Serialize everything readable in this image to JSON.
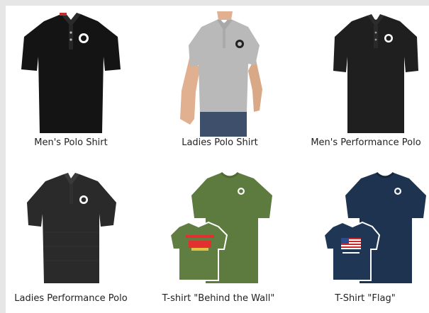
{
  "products": [
    {
      "name": "Men's Polo Shirt"
    },
    {
      "name": "Ladies Polo Shirt"
    },
    {
      "name": "Men's Performance Polo"
    },
    {
      "name": "Ladies Performance Polo"
    },
    {
      "name": "T-shirt \"Behind the Wall\""
    },
    {
      "name": "T-Shirt \"Flag\""
    }
  ],
  "colors": {
    "black_shirt": "#141414",
    "grey_shirt": "#b9b9b9",
    "performance_black": "#1f1f1f",
    "green_shirt": "#5d7a3f",
    "navy_shirt": "#1e3350",
    "page_bg": "#e6e6e6"
  }
}
